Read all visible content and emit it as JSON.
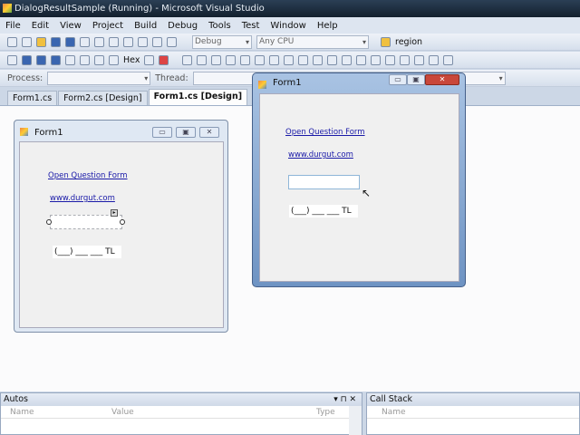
{
  "window": {
    "title": "DialogResultSample (Running) - Microsoft Visual Studio"
  },
  "menu": [
    "File",
    "Edit",
    "View",
    "Project",
    "Build",
    "Debug",
    "Tools",
    "Test",
    "Window",
    "Help"
  ],
  "toolbar": {
    "config": "Debug",
    "platform": "Any CPU",
    "find": "region",
    "hex_label": "Hex"
  },
  "debug_bar": {
    "process_label": "Process:",
    "thread_label": "Thread:"
  },
  "tabs": [
    {
      "label": "Form1.cs"
    },
    {
      "label": "Form2.cs [Design]"
    },
    {
      "label": "Form1.cs [Design]"
    }
  ],
  "designer_form": {
    "title": "Form1",
    "link1": "Open Question Form",
    "link2": "www.durgut.com",
    "masked": "(___) ___ ___ TL"
  },
  "running_form": {
    "title": "Form1",
    "link1": "Open Question Form",
    "link2": "www.durgut.com",
    "masked": "(___) ___ ___ TL"
  },
  "autos": {
    "title": "Autos",
    "columns": [
      "Name",
      "Value",
      "Type"
    ]
  },
  "call_stack": {
    "title": "Call Stack",
    "columns": [
      "Name"
    ]
  }
}
